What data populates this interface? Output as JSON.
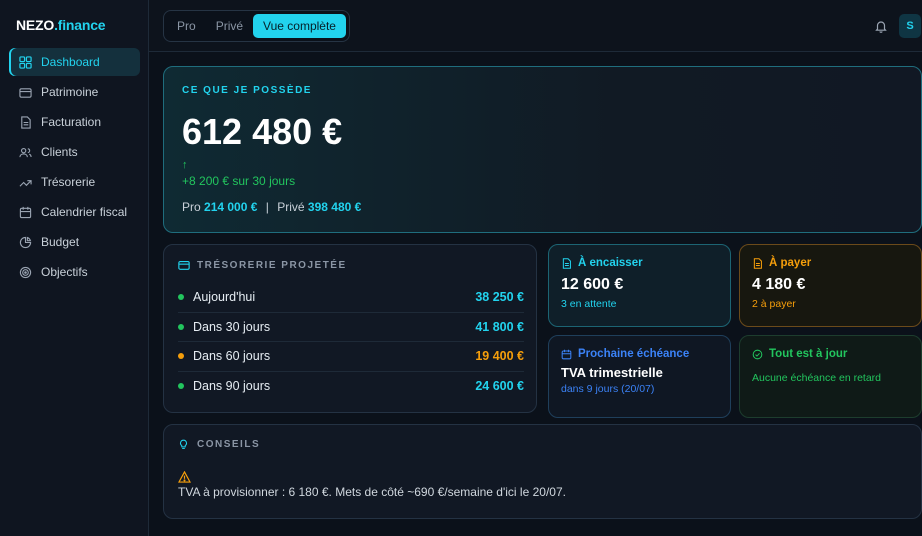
{
  "brand": {
    "name": "NEZO",
    "suffix": ".finance"
  },
  "sidebar": {
    "items": [
      {
        "label": "Dashboard",
        "icon": "dashboard-icon",
        "active": true
      },
      {
        "label": "Patrimoine",
        "icon": "wallet-icon"
      },
      {
        "label": "Facturation",
        "icon": "document-icon"
      },
      {
        "label": "Clients",
        "icon": "users-icon"
      },
      {
        "label": "Trésorerie",
        "icon": "trend-icon"
      },
      {
        "label": "Calendrier fiscal",
        "icon": "calendar-icon"
      },
      {
        "label": "Budget",
        "icon": "pie-icon"
      },
      {
        "label": "Objectifs",
        "icon": "target-icon"
      }
    ]
  },
  "topbar": {
    "segments": [
      "Pro",
      "Privé",
      "Vue complète"
    ],
    "active_segment": "Vue complète",
    "avatar_initial": "S"
  },
  "hero": {
    "label": "CE QUE JE POSSÈDE",
    "amount": "612 480 €",
    "arrow": "↑",
    "change": "+8 200 € sur 30 jours",
    "pro_label": "Pro",
    "pro_value": "214 000 €",
    "sep": "|",
    "prive_label": "Privé",
    "prive_value": "398 480 €"
  },
  "tresorerie": {
    "title": "TRÉSORERIE PROJETÉE",
    "rows": [
      {
        "label": "Aujourd'hui",
        "amount": "38 250 €",
        "status": "green"
      },
      {
        "label": "Dans 30 jours",
        "amount": "41 800 €",
        "status": "green"
      },
      {
        "label": "Dans 60 jours",
        "amount": "19 400 €",
        "status": "orange"
      },
      {
        "label": "Dans 90 jours",
        "amount": "24 600 €",
        "status": "green"
      }
    ]
  },
  "encaisser": {
    "title": "À encaisser",
    "value": "12 600 €",
    "sub": "3 en attente"
  },
  "payer": {
    "title": "À payer",
    "value": "4 180 €",
    "sub": "2 à payer"
  },
  "echeance": {
    "title": "Prochaine échéance",
    "value": "TVA trimestrielle",
    "sub": "dans 9 jours (20/07)"
  },
  "ajour": {
    "title": "Tout est à jour",
    "sub": "Aucune échéance en retard"
  },
  "conseils": {
    "title": "CONSEILS",
    "text": "TVA à provisionner : 6 180 €. Mets de côté ~690 €/semaine d'ici le 20/07."
  },
  "colors": {
    "accent": "#22d3ee",
    "green": "#22c55e",
    "orange": "#f59e0b",
    "blue": "#3b82f6"
  }
}
